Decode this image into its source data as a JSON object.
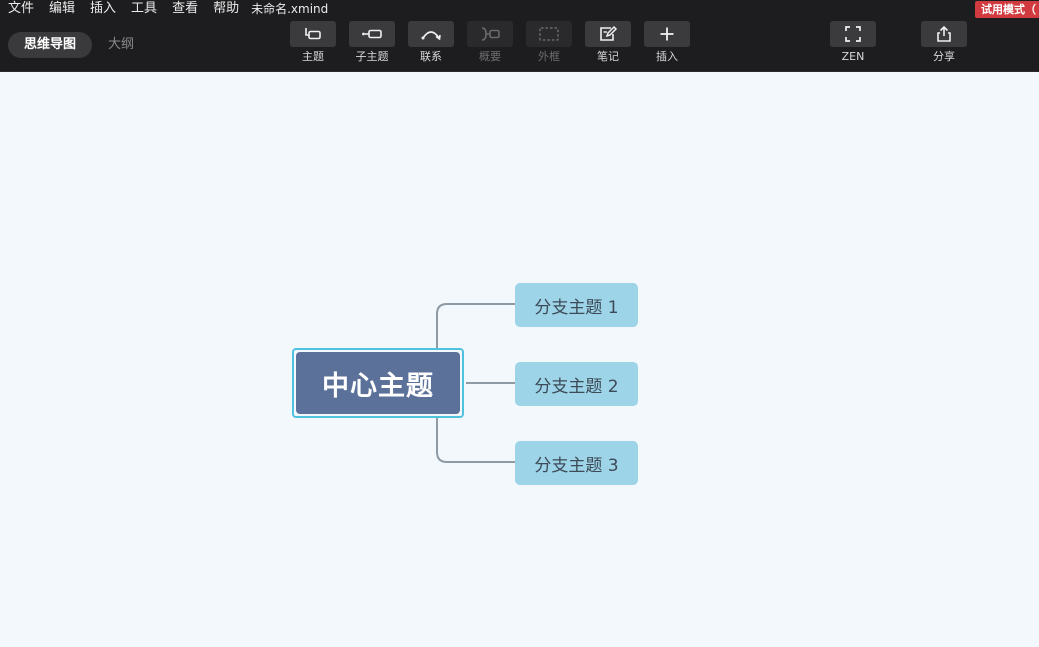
{
  "menubar": {
    "items": [
      "文件",
      "编辑",
      "插入",
      "工具",
      "查看",
      "帮助"
    ],
    "doc_title": "未命名.xmind",
    "trial_badge": "试用模式（"
  },
  "view_tabs": [
    {
      "label": "思维导图",
      "active": true
    },
    {
      "label": "大纲",
      "active": false
    }
  ],
  "toolbar": {
    "topic": {
      "label": "主题",
      "icon": "topic-icon",
      "enabled": true
    },
    "subtopic": {
      "label": "子主题",
      "icon": "subtopic-icon",
      "enabled": true
    },
    "relationship": {
      "label": "联系",
      "icon": "relationship-icon",
      "enabled": true
    },
    "summary": {
      "label": "概要",
      "icon": "summary-icon",
      "enabled": false
    },
    "boundary": {
      "label": "外框",
      "icon": "boundary-icon",
      "enabled": false
    },
    "note": {
      "label": "笔记",
      "icon": "note-icon",
      "enabled": true
    },
    "insert": {
      "label": "插入",
      "icon": "plus-icon",
      "enabled": true
    },
    "zen": {
      "label": "ZEN",
      "icon": "fullscreen-icon",
      "enabled": true
    },
    "share": {
      "label": "分享",
      "icon": "share-icon",
      "enabled": true
    }
  },
  "mindmap": {
    "central_topic": "中心主题",
    "branches": [
      "分支主题 1",
      "分支主题 2",
      "分支主题 3"
    ]
  },
  "colors": {
    "topbar_bg": "#1d1d1f",
    "canvas_bg": "#f3f8fd",
    "central_fill": "#5b7199",
    "selection_outline": "#4fc3dd",
    "branch_fill": "#9dd4e8",
    "connector": "#8e9aa4",
    "trial_badge": "#d13b3f"
  }
}
